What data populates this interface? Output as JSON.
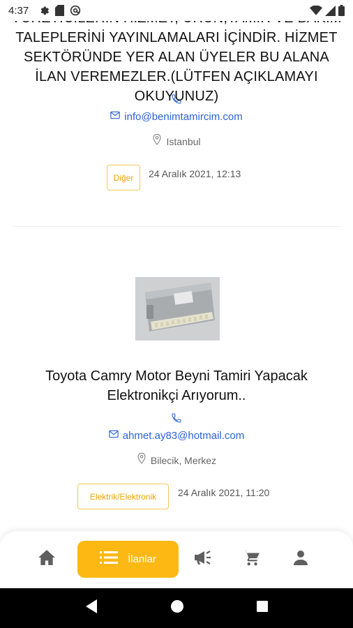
{
  "status_bar": {
    "time": "4:37",
    "left_icons": [
      "gear-icon",
      "sim-card-icon",
      "at-sign-icon"
    ],
    "right_icons": [
      "wifi-icon",
      "signal-icon",
      "battery-icon"
    ]
  },
  "listing_1": {
    "description": "YÜRETİCİLERİN HİZMET, ÜRÜN,TAMİR VE BAKIM TALEPLERİNİ YAYINLAMALARI İÇİNDİR. HİZMET SEKTÖRÜNDE YER ALAN ÜYELER BU ALANA İLAN VEREMEZLER.(LÜTFEN AÇIKLAMAYI OKUYUNUZ)",
    "email": "info@benimtamircim.com",
    "location": "Istanbul",
    "category": "Diğer",
    "date": "24 Aralık 2021, 12:13"
  },
  "listing_2": {
    "title": "Toyota Camry Motor Beyni Tamiri Yapacak Elektronikçi Arıyorum..",
    "email": "ahmet.ay83@hotmail.com",
    "location": "Bilecik, Merkez",
    "category": "Elektrik/Elektronik",
    "date": "24 Aralık 2021, 11:20"
  },
  "bottom_nav": {
    "items": [
      {
        "icon": "home-icon"
      },
      {
        "icon": "list-icon",
        "label": "İlanlar",
        "active": true
      },
      {
        "icon": "megaphone-icon"
      },
      {
        "icon": "cart-icon"
      },
      {
        "icon": "person-icon"
      }
    ],
    "accent_color": "#fdb813"
  },
  "colors": {
    "link": "#2a63d4",
    "badge_text": "#f0a500",
    "badge_border": "#f5c75a"
  }
}
